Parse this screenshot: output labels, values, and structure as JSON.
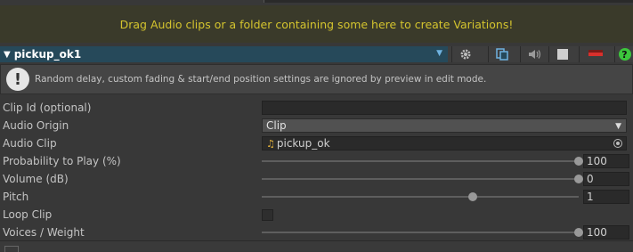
{
  "dropzone": {
    "text": "Drag Audio clips or a folder containing some here to create Variations!"
  },
  "variation": {
    "name": "pickup_ok1"
  },
  "help": {
    "text": "Random delay, custom fading & start/end position settings are ignored by preview in edit mode."
  },
  "fields": {
    "clip_id": {
      "label": "Clip Id (optional)",
      "value": ""
    },
    "audio_origin": {
      "label": "Audio Origin",
      "value": "Clip"
    },
    "audio_clip": {
      "label": "Audio Clip",
      "value": "pickup_ok"
    },
    "probability": {
      "label": "Probability to Play (%)",
      "value": "100",
      "fraction": 1.0
    },
    "volume": {
      "label": "Volume (dB)",
      "value": "0",
      "fraction": 1.0
    },
    "pitch": {
      "label": "Pitch",
      "value": "1",
      "fraction": 0.667
    },
    "loop_clip": {
      "label": "Loop Clip",
      "checked": false
    },
    "voices_weight": {
      "label": "Voices / Weight",
      "value": "100",
      "fraction": 1.0
    }
  },
  "colors": {
    "accent": "#26495a",
    "warning_text": "#d4c42e",
    "help_green": "#3cc63c",
    "delete_red": "#d9302c"
  }
}
